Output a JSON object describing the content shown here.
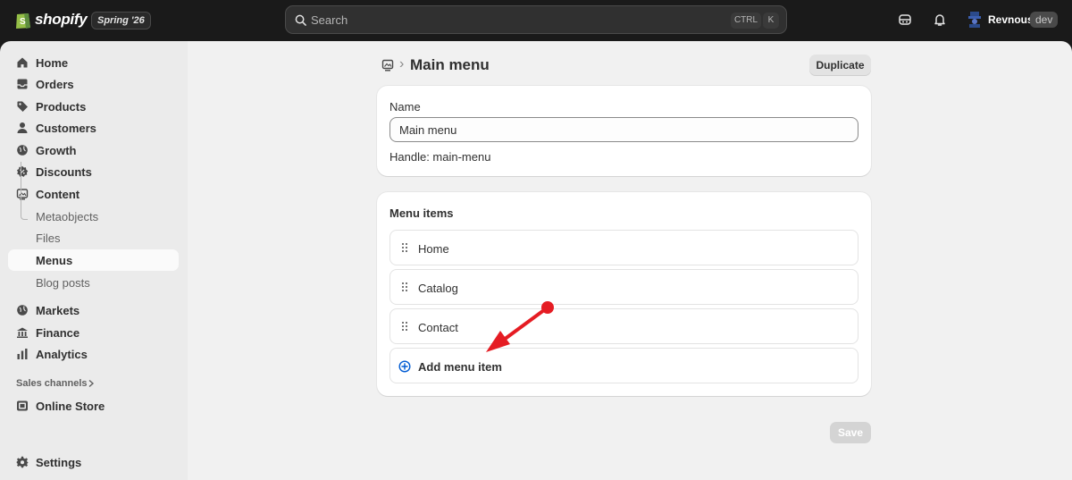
{
  "topbar": {
    "brand": "shopify",
    "edition": "Spring '26",
    "search_placeholder": "Search",
    "shortcut_ctrl": "CTRL",
    "shortcut_k": "K",
    "store_name": "Revnous",
    "store_badge": "dev"
  },
  "sidebar": {
    "items": [
      {
        "label": "Home",
        "icon": "home-icon"
      },
      {
        "label": "Orders",
        "icon": "inbox-icon"
      },
      {
        "label": "Products",
        "icon": "tag-icon"
      },
      {
        "label": "Customers",
        "icon": "person-icon"
      },
      {
        "label": "Growth",
        "icon": "globe-icon"
      },
      {
        "label": "Discounts",
        "icon": "discount-icon"
      },
      {
        "label": "Content",
        "icon": "content-icon"
      }
    ],
    "content_subitems": [
      {
        "label": "Metaobjects"
      },
      {
        "label": "Files"
      },
      {
        "label": "Menus",
        "active": true
      },
      {
        "label": "Blog posts"
      }
    ],
    "lower_items": [
      {
        "label": "Markets",
        "icon": "globe-icon"
      },
      {
        "label": "Finance",
        "icon": "bank-icon"
      },
      {
        "label": "Analytics",
        "icon": "bar-chart-icon"
      }
    ],
    "sales_channels_label": "Sales channels",
    "channels": [
      {
        "label": "Online Store",
        "icon": "store-icon"
      }
    ],
    "settings_label": "Settings"
  },
  "page": {
    "title": "Main menu",
    "duplicate_label": "Duplicate",
    "save_label": "Save"
  },
  "name_card": {
    "label": "Name",
    "value": "Main menu",
    "handle": "Handle: main-menu"
  },
  "menu_card": {
    "title": "Menu items",
    "items": [
      "Home",
      "Catalog",
      "Contact"
    ],
    "add_label": "Add menu item"
  },
  "colors": {
    "accent_blue": "#005bd3",
    "annotation_red": "#e51c23"
  }
}
